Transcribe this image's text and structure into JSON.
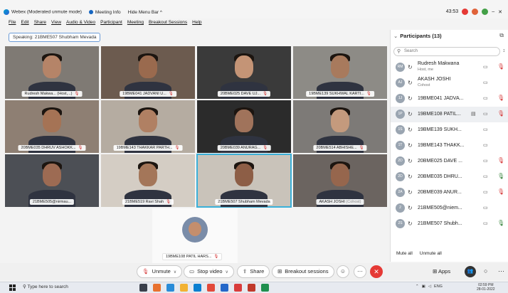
{
  "titlebar": {
    "app_title": "Webex (Moderated unmute mode)",
    "meeting_info": "Meeting Info",
    "hide_menu": "Hide Menu Bar",
    "hide_menu_chev": "^",
    "time": "43:53",
    "minimize": "–",
    "close": "✕"
  },
  "menu": [
    "File",
    "Edit",
    "Share",
    "View",
    "Audio & Video",
    "Participant",
    "Meeting",
    "Breakout Sessions",
    "Help"
  ],
  "speaking": "Speaking: 21BME507 Shubham Mevada",
  "tiles": [
    {
      "name": "Rudresh Makwa... (Host,...)",
      "bg": "#7f7a74",
      "face": "#b58468"
    },
    {
      "name": "19BME041 JADVANI U...",
      "bg": "#6c5b4f",
      "face": "#9a6a4e"
    },
    {
      "name": "20BME025 DAVE UJ...",
      "bg": "#3a3a3a",
      "face": "#c49476"
    },
    {
      "name": "19BME139 SUKHWAL KARTI...",
      "bg": "#8d8b86",
      "face": "#a87a5d"
    },
    {
      "name": "20BME035 DHRUV ASHOKK...",
      "bg": "#8e7f73",
      "face": "#a57355"
    },
    {
      "name": "19BME143 THAKKAR PARTH...",
      "bg": "#b5aca1",
      "face": "#b08063"
    },
    {
      "name": "20BME039 ANURAG...",
      "bg": "#2b2b2b",
      "face": "#a0735b"
    },
    {
      "name": "20BME514 ABHISHE...",
      "bg": "#7d7a77",
      "face": "#c49a7d"
    },
    {
      "name": "21BME505@nirmau...",
      "bg": "#4c4f55",
      "face": "#9d6b53"
    },
    {
      "name": "21BME519 Ravi Shah",
      "bg": "#d4cdc4",
      "face": "#a47659"
    },
    {
      "name": "21BME507 Shubham Mevada",
      "bg": "#c9c3ba",
      "face": "#8d5e46"
    },
    {
      "name": "AKASH JOSHI",
      "sub": "(Cohost)",
      "bg": "#6b6460",
      "face": "#96664d"
    }
  ],
  "selfview": {
    "name": "19BME108 PATIL HARS..."
  },
  "participants": {
    "header": "Participants (13)",
    "search_placeholder": "Search",
    "items": [
      {
        "name": "Rudresh Makwana",
        "sub": "Host, me",
        "initials": "RM",
        "mic": "off"
      },
      {
        "name": "AKASH JOSHI",
        "sub": "Cohost",
        "initials": "AJ",
        "mic": "none"
      },
      {
        "name": "19BME041 JADVA...",
        "initials": "1J",
        "mic": "off"
      },
      {
        "name": "19BME108 PATIL...",
        "initials": "1P",
        "mic": "off",
        "highlight": true
      },
      {
        "name": "19BME139 SUKH...",
        "initials": "1S",
        "mic": "none"
      },
      {
        "name": "19BME143 THAKK...",
        "initials": "1T",
        "mic": "none"
      },
      {
        "name": "20BME025 DAVE ...",
        "initials": "2D",
        "mic": "off"
      },
      {
        "name": "20BME035 DHRU...",
        "initials": "2D",
        "mic": "on"
      },
      {
        "name": "20BME039 ANUR...",
        "initials": "2A",
        "mic": "off"
      },
      {
        "name": "21BME505@niem...",
        "initials": "2",
        "mic": "none"
      },
      {
        "name": "21BME507 Shubh...",
        "initials": "2S",
        "mic": "on"
      }
    ],
    "mute_all": "Mute all",
    "unmute_all": "Unmute all"
  },
  "controls": {
    "unmute": "Unmute",
    "stop_video": "Stop video",
    "share": "Share",
    "breakout": "Breakout sessions",
    "apps": "Apps"
  },
  "taskbar": {
    "search": "Type here to search",
    "tray": "ENG",
    "time": "02:59 PM",
    "date": "28-01-2022"
  },
  "colors": {
    "accent": "#3ab0d9",
    "mute_red": "#d32f2f",
    "end_red": "#e53935",
    "unmute_green": "#2e7d32"
  }
}
